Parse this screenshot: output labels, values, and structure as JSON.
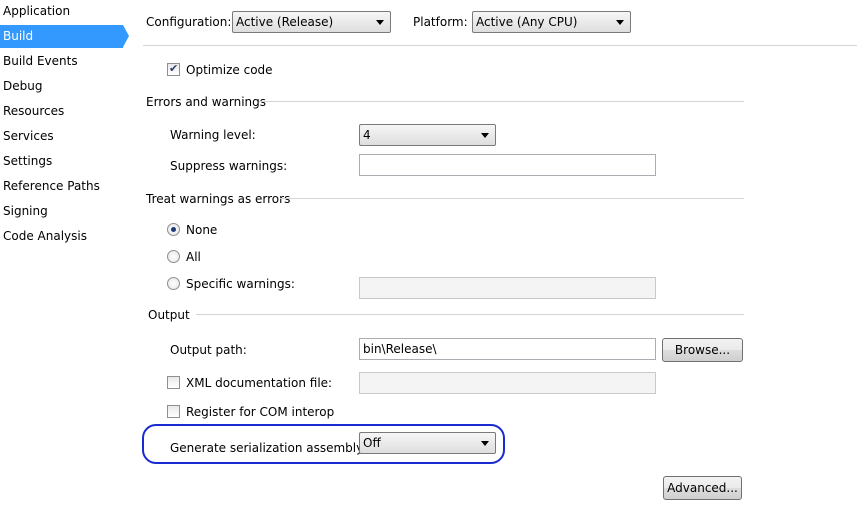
{
  "sidebar": {
    "items": [
      "Application",
      "Build",
      "Build Events",
      "Debug",
      "Resources",
      "Services",
      "Settings",
      "Reference Paths",
      "Signing",
      "Code Analysis"
    ],
    "active_index": 1
  },
  "header": {
    "configuration_label": "Configuration:",
    "configuration_value": "Active (Release)",
    "platform_label": "Platform:",
    "platform_value": "Active (Any CPU)"
  },
  "general": {
    "optimize_code_label": "Optimize code",
    "optimize_code_checked": true
  },
  "errors_warnings": {
    "section_title": "Errors and warnings",
    "warning_level_label": "Warning level:",
    "warning_level_value": "4",
    "suppress_label": "Suppress warnings:",
    "suppress_value": ""
  },
  "treat_warnings": {
    "section_title": "Treat warnings as errors",
    "none_label": "None",
    "all_label": "All",
    "specific_label": "Specific warnings:",
    "selected": "none",
    "specific_value": ""
  },
  "output": {
    "section_title": "Output",
    "output_path_label": "Output path:",
    "output_path_value": "bin\\Release\\",
    "browse_label": "Browse...",
    "xml_doc_label": "XML documentation file:",
    "xml_doc_value": "",
    "com_interop_label": "Register for COM interop",
    "serialization_label": "Generate serialization assembly:",
    "serialization_value": "Off",
    "advanced_label": "Advanced..."
  },
  "colors": {
    "sidebar_active": "#3399ff",
    "annotation": "#1a2ad1"
  }
}
